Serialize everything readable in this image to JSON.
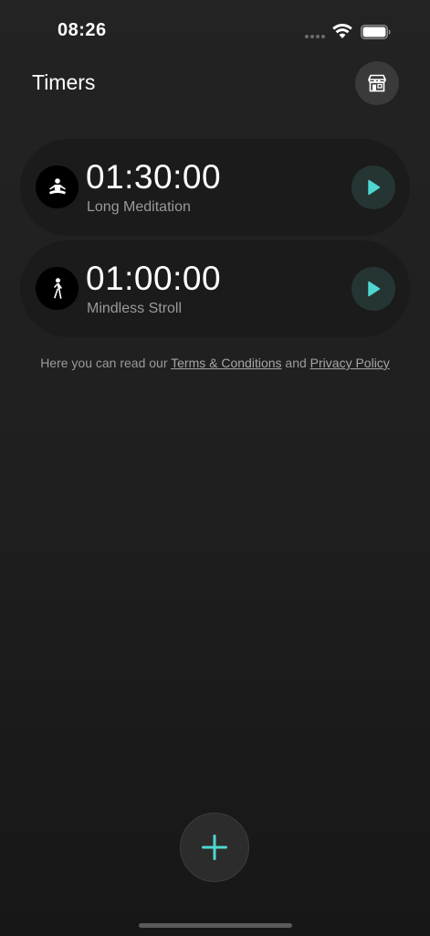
{
  "status_bar": {
    "time": "08:26",
    "icons": [
      "signal-dots",
      "wifi-icon",
      "battery-icon"
    ]
  },
  "header": {
    "title": "Timers",
    "store_icon": "store-icon"
  },
  "timers": [
    {
      "time": "01:30:00",
      "name": "Long Meditation",
      "icon": "meditation-icon"
    },
    {
      "time": "01:00:00",
      "name": "Mindless Stroll",
      "icon": "walking-icon"
    }
  ],
  "legal": {
    "prefix": "Here you can read our ",
    "terms": "Terms & Conditions",
    "and": " and ",
    "privacy": "Privacy Policy"
  },
  "add_button": {
    "icon": "plus-icon"
  },
  "colors": {
    "accent": "#4fd6d0",
    "background": "#202020",
    "card": "#1b1b1b",
    "play_button_bg": "#253533"
  }
}
